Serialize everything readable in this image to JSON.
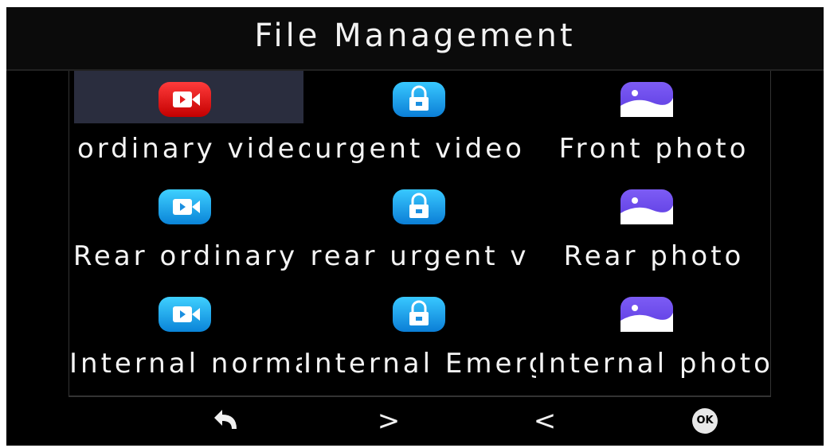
{
  "header": {
    "title": "File Management"
  },
  "files": [
    {
      "label": "ordinary video",
      "icon": "video-camera-icon",
      "color": "#e61e1e",
      "selected": true
    },
    {
      "label": "urgent video",
      "icon": "lock-icon",
      "color": "#19a2f0",
      "selected": false
    },
    {
      "label": "Front photo",
      "icon": "photo-icon",
      "color": "#6a4ae8",
      "selected": false
    },
    {
      "label": "Rear ordinary",
      "icon": "video-camera-icon",
      "color": "#19a2f0",
      "selected": false
    },
    {
      "label": "rear urgent v",
      "icon": "lock-icon",
      "color": "#19a2f0",
      "selected": false
    },
    {
      "label": "Rear photo",
      "icon": "photo-icon",
      "color": "#6a4ae8",
      "selected": false
    },
    {
      "label": "Internal normal",
      "icon": "video-camera-icon",
      "color": "#19a2f0",
      "selected": false
    },
    {
      "label": "Internal Emergency",
      "icon": "lock-icon",
      "color": "#19a2f0",
      "selected": false
    },
    {
      "label": "Internal photo",
      "icon": "photo-icon",
      "color": "#6a4ae8",
      "selected": false
    }
  ],
  "toolbar": {
    "back_icon": "back-arrow-icon",
    "next_label": ">",
    "prev_label": "<",
    "ok_label": "OK"
  }
}
